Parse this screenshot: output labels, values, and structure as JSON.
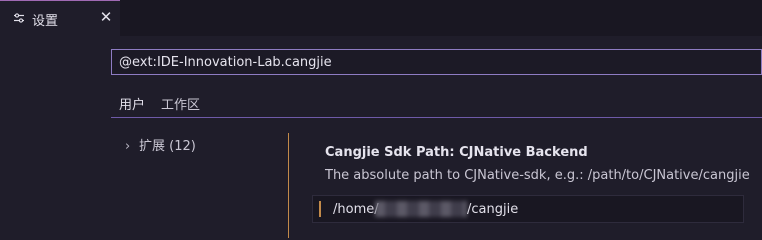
{
  "tab": {
    "icon": "settings-sliders-icon",
    "label": "设置",
    "close_glyph": "✕"
  },
  "search": {
    "value": "@ext:IDE-Innovation-Lab.cangjie"
  },
  "scope_tabs": {
    "user": "用户",
    "workspace": "工作区"
  },
  "toc": {
    "extensions_label": "扩展 (12)",
    "chevron": "›"
  },
  "setting": {
    "title": "Cangjie Sdk Path: CJNative Backend",
    "description": "The absolute path to CJNative-sdk, e.g.: /path/to/CJNative/cangjie",
    "value_prefix": "/home/",
    "value_suffix": "/cangjie"
  },
  "colors": {
    "accent_border": "#8e7cc3",
    "modified_bar": "#c28a4a",
    "background": "#1f1d2a"
  }
}
